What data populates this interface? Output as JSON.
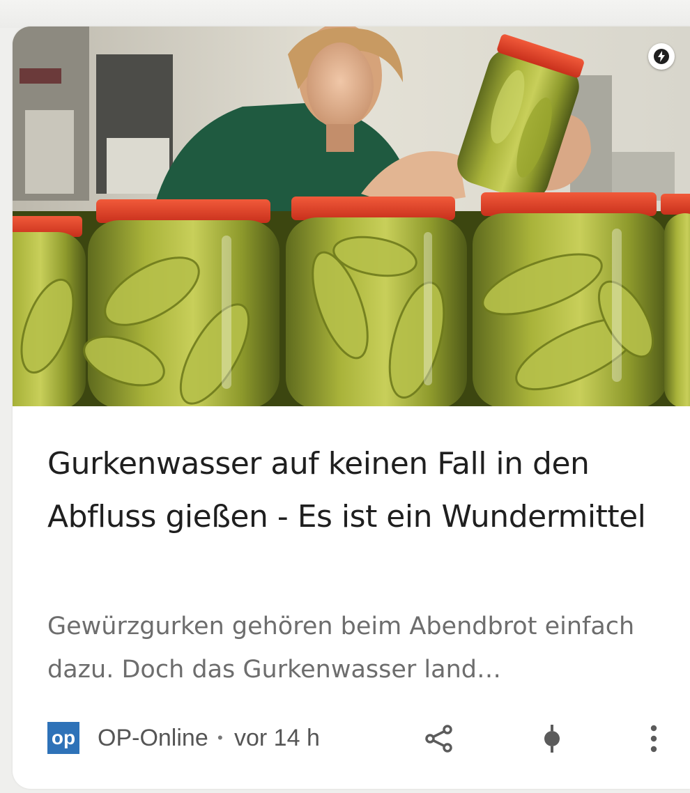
{
  "article": {
    "title": "Gurkenwasser auf keinen Fall in den Abfluss gießen - Es ist ein Wundermittel",
    "snippet": "Gewürzgurken gehören beim Abendbrot einfach dazu. Doch das Gurkenwasser land…",
    "image_alt": "Frau prüft Gläser mit eingelegten Gurken",
    "amp_icon": "lightning-bolt-icon"
  },
  "source": {
    "logo_text": "op",
    "name": "OP-Online",
    "separator": "•",
    "age": "vor 14 h",
    "logo_color": "#2e72b8"
  },
  "actions": {
    "share_icon": "share-icon",
    "follow_icon": "pin-icon",
    "more_icon": "more-vert-icon"
  }
}
